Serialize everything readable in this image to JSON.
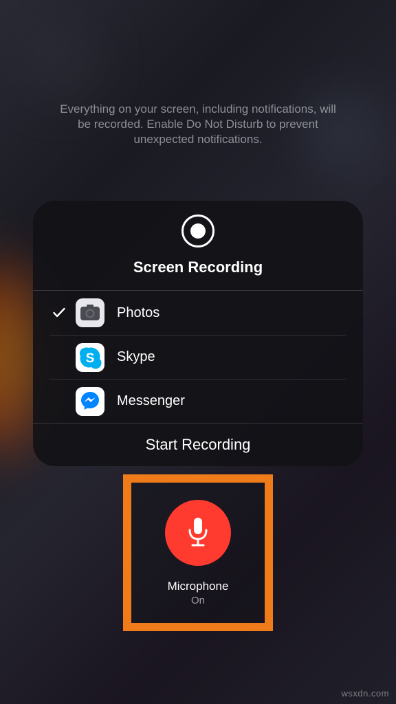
{
  "instruction": "Everything on your screen, including notifications, will be recorded. Enable Do Not Disturb to prevent unexpected notifications.",
  "sheet": {
    "title": "Screen Recording",
    "apps": [
      {
        "label": "Photos",
        "selected": true
      },
      {
        "label": "Skype",
        "selected": false
      },
      {
        "label": "Messenger",
        "selected": false
      }
    ],
    "start": "Start Recording"
  },
  "mic": {
    "label": "Microphone",
    "state": "On",
    "color": "#ff3a2f"
  },
  "highlight_color": "#ef7b1a",
  "watermark": "wsxdn.com"
}
